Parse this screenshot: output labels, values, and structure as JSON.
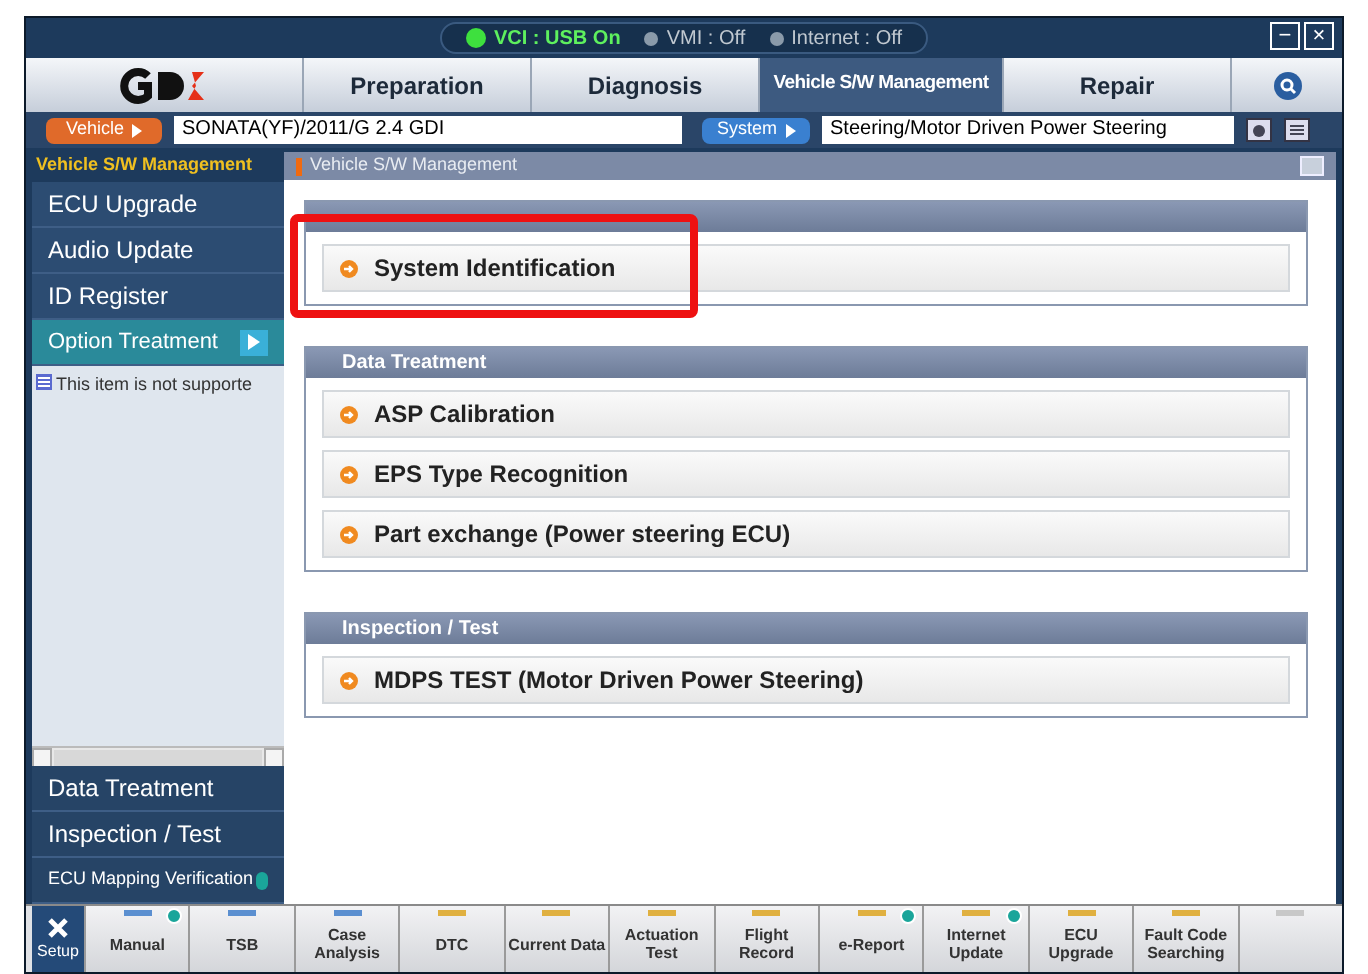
{
  "status": {
    "vci": "VCI : USB On",
    "vci_on": true,
    "vmi": "VMI : Off",
    "internet": "Internet : Off"
  },
  "window_buttons": [
    "−",
    "×"
  ],
  "tabs": [
    {
      "label": "Preparation",
      "selected": false
    },
    {
      "label": "Diagnosis",
      "selected": false
    },
    {
      "label": "Vehicle S/W Management",
      "selected": true
    },
    {
      "label": "Repair",
      "selected": false
    }
  ],
  "vehicle_bar": {
    "vehicle_label": "Vehicle",
    "vehicle_value": "SONATA(YF)/2011/G 2.4 GDI",
    "system_label": "System",
    "system_value": "Steering/Motor Driven Power Steering"
  },
  "sidebar": {
    "title": "Vehicle S/W Management",
    "items": [
      {
        "label": "ECU Upgrade",
        "selected": false
      },
      {
        "label": "Audio Update",
        "selected": false
      },
      {
        "label": "ID Register",
        "selected": false
      },
      {
        "label": "Option Treatment",
        "selected": true
      }
    ],
    "notice": "This item is not supporte",
    "bottom_items": [
      {
        "label": "Data Treatment",
        "small": false,
        "badge": false
      },
      {
        "label": "Inspection / Test",
        "small": false,
        "badge": false
      },
      {
        "label": "ECU Mapping Verification",
        "small": true,
        "badge": true
      }
    ]
  },
  "content": {
    "breadcrumb": "Vehicle S/W Management",
    "sections": [
      {
        "highlighted": true,
        "items": [
          "System Identification"
        ]
      },
      {
        "title": "Data Treatment",
        "highlighted": false,
        "items": [
          "ASP Calibration",
          "EPS Type Recognition",
          "Part exchange (Power steering ECU)"
        ]
      },
      {
        "title": "Inspection / Test",
        "highlighted": false,
        "items": [
          "MDPS TEST (Motor Driven Power Steering)"
        ]
      }
    ]
  },
  "toolbar": {
    "setup": "Setup",
    "items": [
      {
        "label": "Manual",
        "color": "#5b8fd0",
        "badge": true
      },
      {
        "label": "TSB",
        "color": "#5b8fd0",
        "badge": false
      },
      {
        "label": "Case Analysis",
        "color": "#5b8fd0",
        "badge": false
      },
      {
        "label": "DTC",
        "color": "#e0b040",
        "badge": false
      },
      {
        "label": "Current Data",
        "color": "#e0b040",
        "badge": false
      },
      {
        "label": "Actuation Test",
        "color": "#e0b040",
        "badge": false
      },
      {
        "label": "Flight Record",
        "color": "#e0b040",
        "badge": false
      },
      {
        "label": "e-Report",
        "color": "#e0b040",
        "badge": true
      },
      {
        "label": "Internet Update",
        "color": "#e0b040",
        "badge": true
      },
      {
        "label": "ECU Upgrade",
        "color": "#e0b040",
        "badge": false
      },
      {
        "label": "Fault Code Searching",
        "color": "#e0b040",
        "badge": false
      },
      {
        "color": "#c8c8c8",
        "badge": false
      }
    ]
  }
}
